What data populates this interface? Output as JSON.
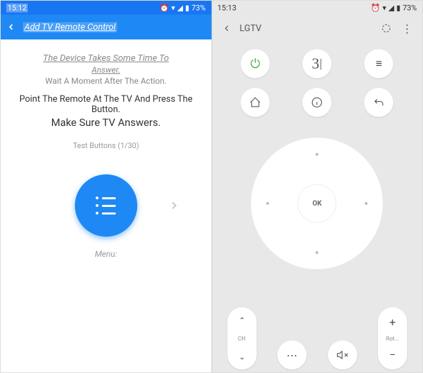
{
  "left": {
    "status": {
      "time": "15:12",
      "battery": "73%"
    },
    "appbar": {
      "title": "Add TV Remote Control"
    },
    "instr1": "The Device Takes Some Time To",
    "instr2": "Answer.",
    "instr3": "Wait A Moment After The Action.",
    "instr4": "Point The Remote At The TV And Press The Button.",
    "instr5": "Make Sure TV Answers.",
    "test_label": "Test Buttons (1/30)",
    "button_label": "Menu:"
  },
  "right": {
    "status": {
      "time": "15:13",
      "battery": "73%"
    },
    "appbar": {
      "title": "LGTV"
    },
    "num_display": "3",
    "dpad_ok": "OK",
    "ch_label": "CH",
    "vol_label": "Rot..."
  }
}
